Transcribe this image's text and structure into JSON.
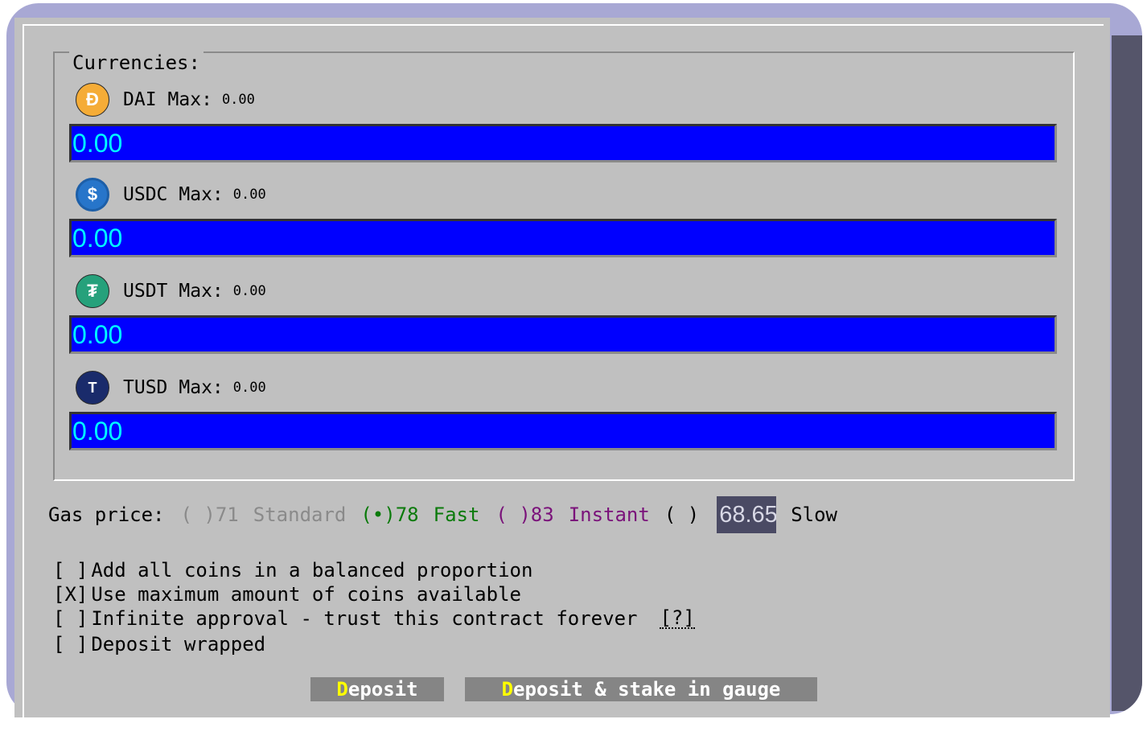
{
  "currencies": {
    "legend": "Currencies:",
    "coins": [
      {
        "name": "DAI",
        "max_label": "Max:",
        "max_value": "0.00",
        "amount": "0.00",
        "icon": "dai-icon",
        "color": "#f5ac37",
        "glyph": "Ð"
      },
      {
        "name": "USDC",
        "max_label": "Max:",
        "max_value": "0.00",
        "amount": "0.00",
        "icon": "usdc-icon",
        "color": "#2775ca",
        "glyph": "$"
      },
      {
        "name": "USDT",
        "max_label": "Max:",
        "max_value": "0.00",
        "amount": "0.00",
        "icon": "usdt-icon",
        "color": "#26a17b",
        "glyph": "₮"
      },
      {
        "name": "TUSD",
        "max_label": "Max:",
        "max_value": "0.00",
        "amount": "0.00",
        "icon": "tusd-icon",
        "color": "#1a2b6b",
        "glyph": "T"
      }
    ]
  },
  "gas": {
    "label": "Gas price:",
    "options": [
      {
        "radio": "( )",
        "value": "71",
        "label": "Standard",
        "color": "#8a8a8a",
        "selected": false
      },
      {
        "radio": "(•)",
        "value": "78",
        "label": "Fast",
        "color": "#0a7a0a",
        "selected": true
      },
      {
        "radio": "( )",
        "value": "83",
        "label": "Instant",
        "color": "#7a127a",
        "selected": false
      }
    ],
    "custom_radio": "( )",
    "custom_value": "68.65",
    "custom_label": "Slow"
  },
  "options": [
    {
      "box": "[ ]",
      "label": "Add all coins in a balanced proportion",
      "checked": false
    },
    {
      "box": "[X]",
      "label": "Use maximum amount of coins available",
      "checked": true
    },
    {
      "box": "[ ]",
      "label": "Infinite approval - trust this contract forever",
      "help": "[?]",
      "checked": false
    },
    {
      "box": "[ ]",
      "label": "Deposit wrapped",
      "checked": false
    }
  ],
  "buttons": {
    "deposit": {
      "hotkey": "D",
      "rest": "eposit"
    },
    "deposit_stake": {
      "hotkey": "D",
      "rest": "eposit & stake in gauge"
    }
  }
}
